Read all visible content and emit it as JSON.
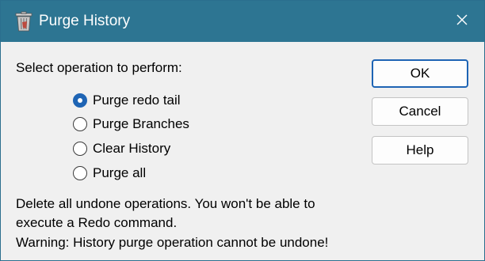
{
  "window": {
    "title": "Purge History",
    "icon": "trash-can-icon",
    "close_icon": "close-icon",
    "title_bar_color": "#2d7592",
    "accent_color": "#1e64b4"
  },
  "prompt": "Select operation to perform:",
  "options": [
    {
      "label": "Purge redo tail",
      "selected": true
    },
    {
      "label": "Purge Branches",
      "selected": false
    },
    {
      "label": "Clear History",
      "selected": false
    },
    {
      "label": "Purge all",
      "selected": false
    }
  ],
  "description": "Delete all undone operations. You won't be able to execute a Redo command.",
  "warning": "Warning: History purge operation cannot be undone!",
  "buttons": {
    "ok": "OK",
    "cancel": "Cancel",
    "help": "Help"
  }
}
